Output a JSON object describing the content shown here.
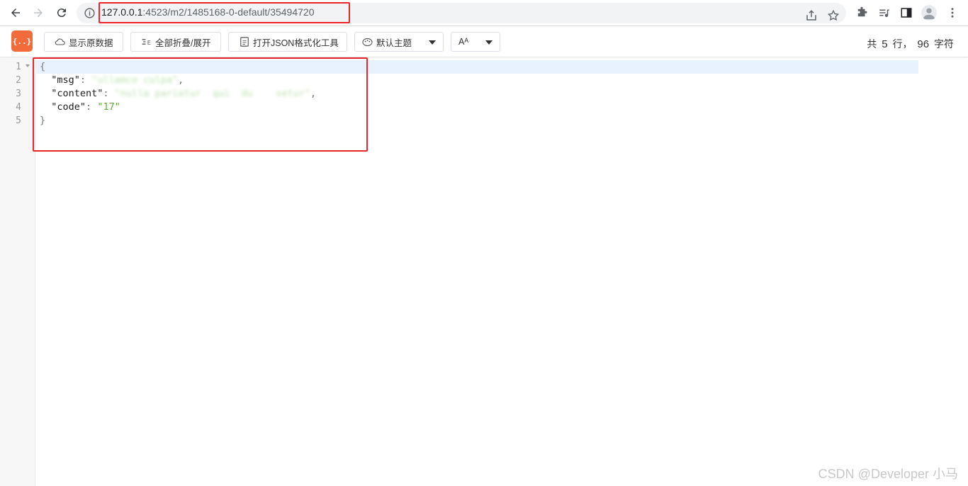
{
  "browser": {
    "url_host": "127.0.0.1",
    "url_rest": ":4523/m2/1485168-0-default/35494720"
  },
  "toolbar": {
    "logo_text": "{..}",
    "show_raw_label": "显示原数据",
    "fold_all_label": "全部折叠/展开",
    "open_formatter_label": "打开JSON格式化工具",
    "theme_label": "默认主题",
    "font_label": "Aᴬ",
    "stats_prefix": "共",
    "line_count": "5",
    "stats_mid": "行，",
    "char_count": "96",
    "stats_suffix": "字符"
  },
  "editor": {
    "line_numbers": [
      "1",
      "2",
      "3",
      "4",
      "5"
    ],
    "lines": {
      "l1_brace": "{",
      "l2_key": "\"msg\"",
      "l2_value": "\"ullamco culpa\"",
      "l3_key": "\"content\"",
      "l3_value": "\"nulla pariatur  qui  du    setur\"",
      "l4_key": "\"code\"",
      "l4_value": "\"17\"",
      "l5_brace": "}"
    }
  },
  "watermark": "CSDN @Developer 小马",
  "colors": {
    "accent_orange": "#f26b3a",
    "highlight_red": "#e8262a",
    "string_green": "#5fa83d",
    "active_line": "#e8f2ff"
  }
}
